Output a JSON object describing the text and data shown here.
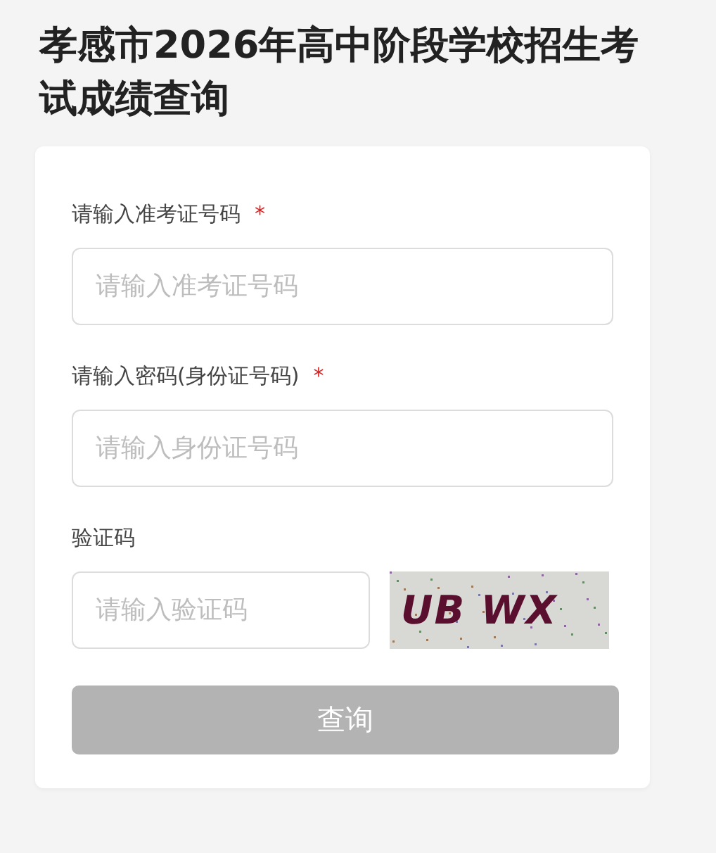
{
  "title": "孝感市2026年高中阶段学校招生考试成绩查询",
  "fields": [
    {
      "kind": "text",
      "label": "请输入准考证号码",
      "required_mark": "*",
      "placeholder": "请输入准考证号码"
    },
    {
      "kind": "text",
      "label": "请输入密码(身份证号码)",
      "required_mark": "*",
      "placeholder": "请输入身份证号码"
    },
    {
      "kind": "captcha",
      "label": "验证码",
      "placeholder": "请输入验证码",
      "code": "UB WX"
    }
  ],
  "submit": {
    "label": "查询",
    "disabled": true
  }
}
